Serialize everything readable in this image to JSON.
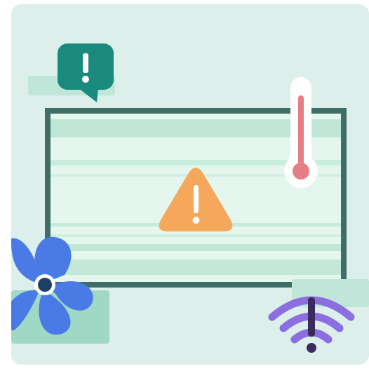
{
  "illustration": {
    "speech_bubble_icon": "exclamation-speech-bubble",
    "center_icon": "warning-triangle",
    "thermometer_icon": "thermometer-high",
    "fan_icon": "fan",
    "wifi_icon": "wifi-warning"
  },
  "colors": {
    "card_background": "#dcefea",
    "panel_frame": "#3f6e67",
    "panel_fill": "#e4f6ee",
    "panel_stripe": "#b8e3d3",
    "speech_bubble": "#1b8a7e",
    "warning_triangle": "#f5a75b",
    "thermometer_fill": "#e57e87",
    "fan_blade": "#4a7ae6",
    "fan_hub": "#1f3f66",
    "wifi": "#8b6fe0",
    "wifi_bang": "#3b2b5e",
    "accent_block": "#9fd9c6"
  }
}
